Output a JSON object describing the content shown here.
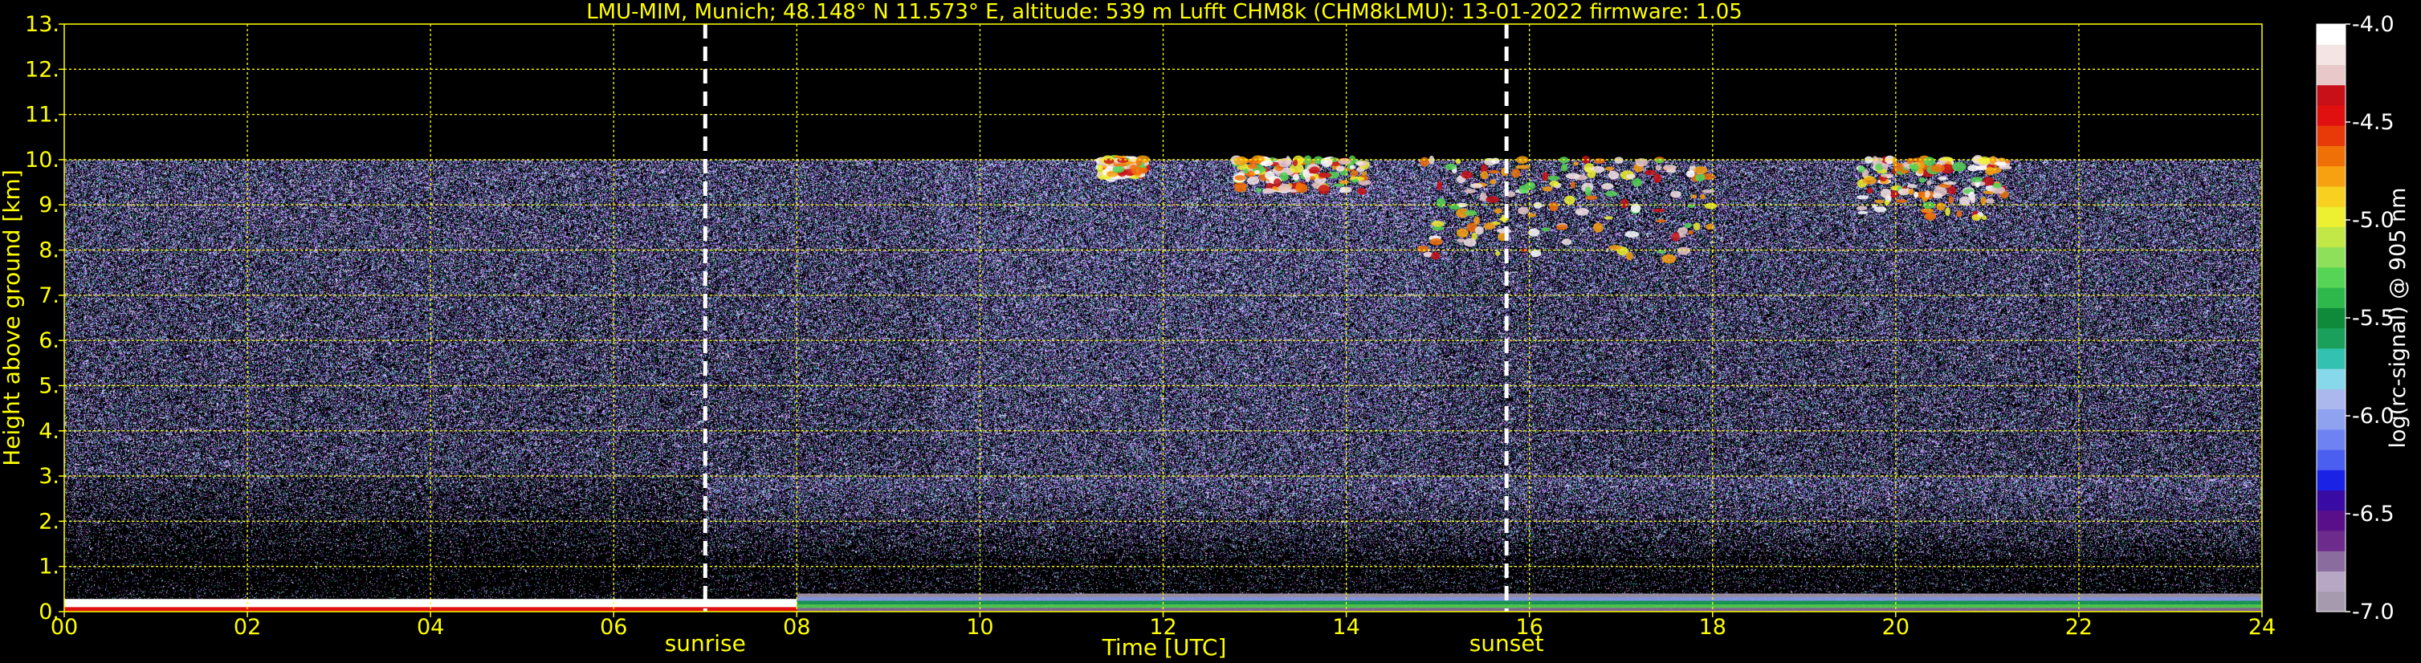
{
  "chart_data": {
    "type": "heatmap",
    "title": "LMU-MIM, Munich; 48.148° N 11.573° E, altitude: 539 m    Lufft CHM8k (CHM8kLMU): 13-01-2022    firmware: 1.05",
    "xlabel": "Time [UTC]",
    "ylabel": "Height above ground [km]",
    "xlim": [
      0,
      24
    ],
    "ylim": [
      0,
      13
    ],
    "x_tick_labels": [
      "00",
      "02",
      "04",
      "06",
      "08",
      "10",
      "12",
      "14",
      "16",
      "18",
      "20",
      "22",
      "24"
    ],
    "y_tick_labels": [
      "0.",
      "1.",
      "2.",
      "3.",
      "4.",
      "5.",
      "6.",
      "7.",
      "8.",
      "9.",
      "10.",
      "11.",
      "12.",
      "13."
    ],
    "grid": true,
    "data_top_km": 10,
    "events": [
      {
        "name": "sunrise",
        "time": 7.0
      },
      {
        "name": "sunset",
        "time": 15.75
      }
    ],
    "colorbar": {
      "label": "log(rc-signal) @ 905 nm",
      "range": [
        -7.0,
        -4.0
      ],
      "tick_labels": [
        "-4.0",
        "-4.5",
        "-5.0",
        "-5.5",
        "-6.0",
        "-6.5",
        "-7.0"
      ],
      "colors": [
        "#a69aae",
        "#b7a6c4",
        "#8b6c9e",
        "#6d2b8c",
        "#5a0f8a",
        "#3a0aa5",
        "#1a22e6",
        "#4a5ef0",
        "#6f82f2",
        "#8ea2f0",
        "#aab8ee",
        "#86d8ea",
        "#33c2b2",
        "#1aa05a",
        "#0f8a3a",
        "#2eb84c",
        "#55d455",
        "#8ee05a",
        "#c2e848",
        "#ecf030",
        "#f7d020",
        "#f7a010",
        "#f07008",
        "#e83a08",
        "#e01010",
        "#c81018",
        "#e8c8c8",
        "#f4e4e4",
        "#ffffff"
      ]
    },
    "features": [
      {
        "type": "cloud",
        "time_start": 14.8,
        "time_end": 18.0,
        "height_min_km": 7.8,
        "height_max_km": 10
      },
      {
        "type": "cloud",
        "time_start": 12.8,
        "time_end": 14.2,
        "height_min_km": 9.3,
        "height_max_km": 10
      },
      {
        "type": "cloud",
        "time_start": 19.6,
        "time_end": 21.2,
        "height_min_km": 8.7,
        "height_max_km": 10
      },
      {
        "type": "cloud",
        "time_start": 11.3,
        "time_end": 11.8,
        "height_min_km": 9.6,
        "height_max_km": 10
      },
      {
        "type": "aerosol_layer",
        "time_start": 8.0,
        "time_end": 24,
        "height_min_km": 0,
        "height_max_km": 0.4
      }
    ]
  }
}
